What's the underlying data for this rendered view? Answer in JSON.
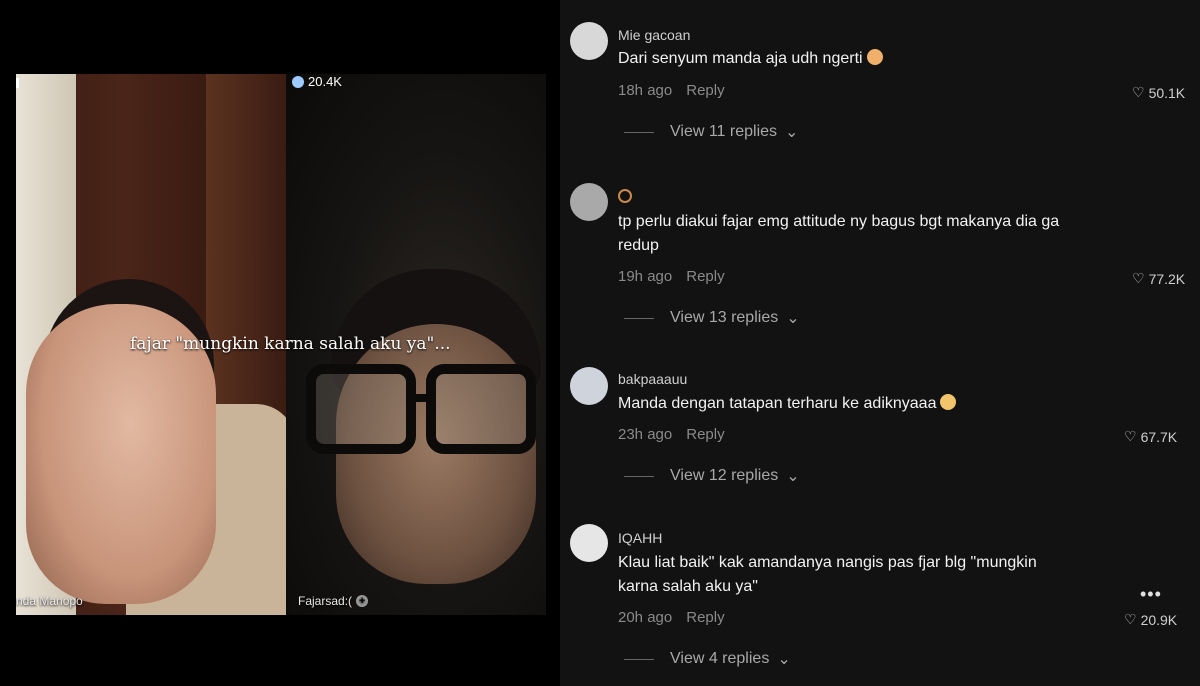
{
  "video": {
    "viewer_count": "20.4K",
    "caption": "fajar \"mungkin karna salah aku ya\"...",
    "left_name": "nda Manopo",
    "right_name": "Fajarsad:(",
    "right_badge": "+"
  },
  "comments": [
    {
      "username": "Mie gacoan",
      "text": "Dari senyum manda aja udh ngerti",
      "time": "18h ago",
      "reply_label": "Reply",
      "likes": "50.1K",
      "view_replies": "View 11 replies"
    },
    {
      "username": "",
      "text": "tp perlu diakui fajar emg attitude ny bagus bgt makanya dia ga redup",
      "time": "19h ago",
      "reply_label": "Reply",
      "likes": "77.2K",
      "view_replies": "View 13 replies"
    },
    {
      "username": "bakpaaauu",
      "text": "Manda dengan tatapan terharu ke adiknyaaa",
      "time": "23h ago",
      "reply_label": "Reply",
      "likes": "67.7K",
      "view_replies": "View 12 replies"
    },
    {
      "username": "IQAHH",
      "text": "Klau liat baik\" kak amandanya nangis pas fjar blg \"mungkin karna salah aku ya\"",
      "time": "20h ago",
      "reply_label": "Reply",
      "likes": "20.9K",
      "view_replies": "View 4 replies"
    }
  ],
  "icons": {
    "heart": "heart-icon",
    "chevron": "chevron-down-icon",
    "more": "more-options-icon"
  }
}
